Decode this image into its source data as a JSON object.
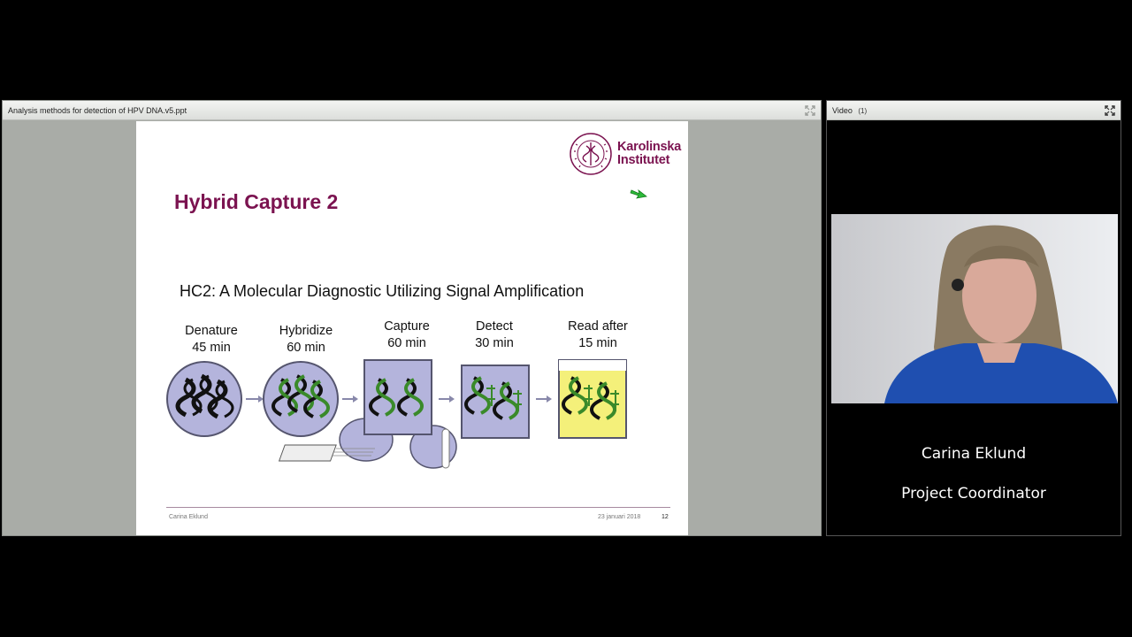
{
  "share_pod": {
    "title": "Analysis methods for detection of HPV DNA.v5.ppt"
  },
  "video_pod": {
    "title": "Video",
    "count": "(1)",
    "presenter_name": "Carina Eklund",
    "presenter_role": "Project Coordinator"
  },
  "slide": {
    "logo_line1": "Karolinska",
    "logo_line2": "Institutet",
    "logo_seal_text": "KAROLINSKA INSTITUTET ANNO 1810",
    "title": "Hybrid Capture 2",
    "subtitle": "HC2: A Molecular Diagnostic Utilizing Signal Amplification",
    "steps": [
      {
        "line1": "Denature",
        "line2": "45 min"
      },
      {
        "line1": "Hybridize",
        "line2": "60 min"
      },
      {
        "line1": "Capture",
        "line2": "60 min"
      },
      {
        "line1": "Detect",
        "line2": "30 min"
      },
      {
        "line1": "Read after",
        "line2": "15 min"
      }
    ],
    "footer_author": "Carina Eklund",
    "footer_date": "23 januari 2018",
    "footer_page": "12"
  },
  "colors": {
    "brand": "#7b1350",
    "vessel": "#b4b4dc",
    "read_fill": "#f4f07a",
    "dna_green": "#3a8a2a"
  }
}
